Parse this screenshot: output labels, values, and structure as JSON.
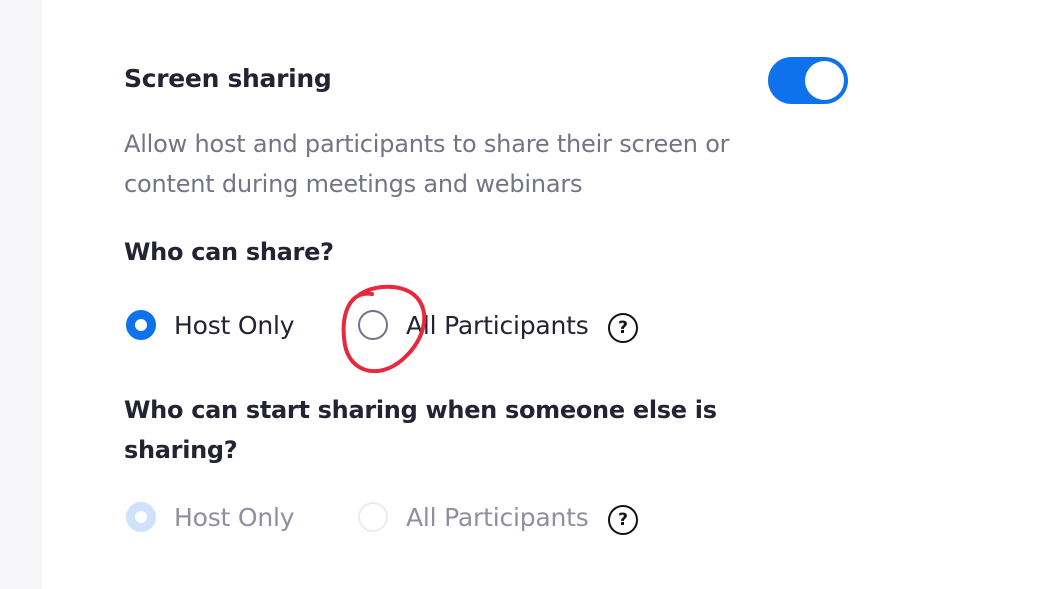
{
  "section": {
    "title": "Screen sharing",
    "toggle_on": true,
    "description": "Allow host and participants to share their screen or content during meetings and webinars"
  },
  "who_can_share": {
    "question": "Who can share?",
    "options": [
      {
        "label": "Host Only",
        "selected": true,
        "disabled": false
      },
      {
        "label": "All Participants",
        "selected": false,
        "disabled": false
      }
    ],
    "help_icon": "?"
  },
  "who_can_start": {
    "question": "Who can start sharing when someone else is sharing?",
    "options": [
      {
        "label": "Host Only",
        "selected": true,
        "disabled": true
      },
      {
        "label": "All Participants",
        "selected": false,
        "disabled": true
      }
    ],
    "help_icon": "?"
  },
  "colors": {
    "accent": "#0e72ed",
    "title_text": "#232333",
    "description_text": "#747487",
    "annotation": "#e8283c"
  }
}
